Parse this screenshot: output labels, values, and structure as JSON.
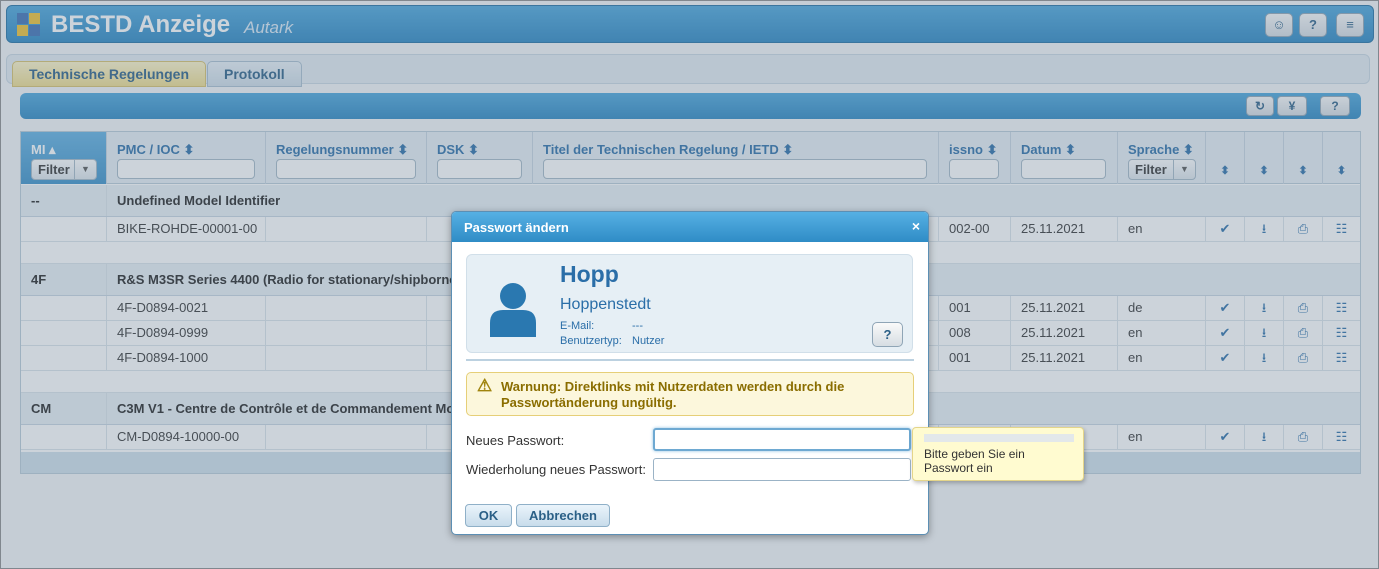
{
  "app": {
    "title": "BESTD Anzeige",
    "subtitle": "Autark",
    "header_buttons": [
      {
        "icon": "user-icon",
        "glyph": "☺"
      },
      {
        "icon": "help-icon",
        "glyph": "?"
      },
      {
        "icon": "menu-icon",
        "glyph": "≡"
      }
    ]
  },
  "tabs": [
    {
      "label": "Technische Regelungen",
      "active": true
    },
    {
      "label": "Protokoll",
      "active": false
    }
  ],
  "toolbar": {
    "refresh_glyph": "↻",
    "filter_glyph": "¥",
    "help_glyph": "?"
  },
  "table": {
    "columns": {
      "mi": "MI ▴",
      "pmc": "PMC / IOC ⬍",
      "regnr": "Regelungsnummer ⬍",
      "dsk": "DSK ⬍",
      "titel": "Titel der Technischen Regelung / IETD ⬍",
      "issno": "issno ⬍",
      "datum": "Datum ⬍",
      "sprache": "Sprache ⬍"
    },
    "filter_label": "Filter",
    "sort_glyph": "⬍",
    "groups": [
      {
        "mi": "--",
        "title": "Undefined Model Identifier",
        "rows": [
          {
            "pmc": "BIKE-ROHDE-00001-00",
            "issno": "002-00",
            "datum": "25.11.2021",
            "sprache": "en"
          }
        ]
      },
      {
        "mi": "4F",
        "title": "R&S M3SR Series 4400 (Radio for stationary/shipborne",
        "rows": [
          {
            "pmc": "4F-D0894-0021",
            "issno": "001",
            "datum": "25.11.2021",
            "sprache": "de"
          },
          {
            "pmc": "4F-D0894-0999",
            "issno": "008",
            "datum": "25.11.2021",
            "sprache": "en"
          },
          {
            "pmc": "4F-D0894-1000",
            "issno": "001",
            "datum": "25.11.2021",
            "sprache": "en"
          }
        ]
      },
      {
        "mi": "CM",
        "title": "C3M V1 - Centre de Contrôle et de Commandement Mob",
        "rows": [
          {
            "pmc": "CM-D0894-10000-00",
            "issno": "",
            "datum": "",
            "sprache": "en"
          }
        ]
      }
    ],
    "action_icons": [
      "check-icon",
      "download-icon",
      "pdf-icon",
      "document-icon"
    ],
    "action_glyphs": [
      "✔",
      "⭳",
      "⎙",
      "☷"
    ]
  },
  "dialog": {
    "title": "Passwort ändern",
    "close_glyph": "×",
    "user": {
      "short_name": "Hopp",
      "full_name": "Hoppenstedt",
      "email_label": "E-Mail:",
      "email_value": "---",
      "type_label": "Benutzertyp:",
      "type_value": "Nutzer"
    },
    "help_glyph": "?",
    "warning_line1": "Warnung: Direktlinks mit Nutzerdaten werden durch die",
    "warning_line2": "Passwortänderung ungültig.",
    "new_password_label": "Neues Passwort:",
    "repeat_password_label": "Wiederholung neues Passwort:",
    "ok_label": "OK",
    "cancel_label": "Abbrechen"
  },
  "tooltip": {
    "line1": "Bitte geben Sie ein",
    "line2": "Passwort ein"
  }
}
